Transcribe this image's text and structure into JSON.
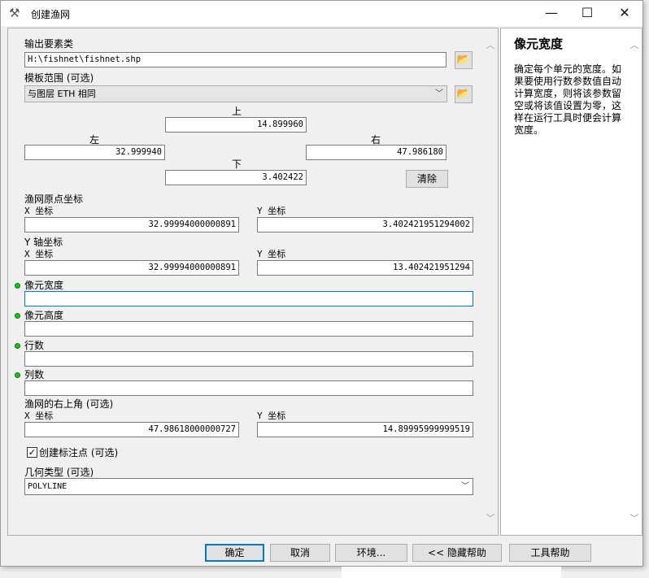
{
  "window": {
    "title": "创建渔网",
    "minimize_glyph": "—",
    "maximize_glyph": "☐",
    "close_glyph": "✕"
  },
  "icons": {
    "title_icon": "hammer-icon",
    "folder_icon": "open-folder-icon",
    "chevron": "chevron-down-icon",
    "scroll_up": "scroll-up-icon",
    "scroll_down": "scroll-down-icon"
  },
  "form": {
    "output_label": "输出要素类",
    "output_value": "H:\\fishnet\\fishnet.shp",
    "template_label": "模板范围 (可选)",
    "template_value": "与图层 ETH 相同",
    "extent": {
      "top_label": "上",
      "top_value": "14.899960",
      "left_label": "左",
      "left_value": "32.999940",
      "right_label": "右",
      "right_value": "47.986180",
      "bottom_label": "下",
      "bottom_value": "3.402422",
      "clear_button": "清除"
    },
    "origin_label": "渔网原点坐标",
    "origin_x_label": "X 坐标",
    "origin_x_value": "32.99994000000891",
    "origin_y_label": "Y 坐标",
    "origin_y_value": "3.402421951294002",
    "yaxis_label": "Y 轴坐标",
    "yaxis_x_label": "X 坐标",
    "yaxis_x_value": "32.99994000000891",
    "yaxis_y_label": "Y 坐标",
    "yaxis_y_value": "13.402421951294",
    "cell_width_label": "像元宽度",
    "cell_width_value": "",
    "cell_height_label": "像元高度",
    "cell_height_value": "",
    "rows_label": "行数",
    "rows_value": "",
    "cols_label": "列数",
    "cols_value": "",
    "corner_label": "渔网的右上角 (可选)",
    "corner_x_label": "X 坐标",
    "corner_x_value": "47.98618000000727",
    "corner_y_label": "Y 坐标",
    "corner_y_value": "14.89995999999519",
    "label_points_checkbox": "创建标注点 (可选)",
    "label_points_checked": "✓",
    "geometry_label": "几何类型 (可选)",
    "geometry_value": "POLYLINE"
  },
  "help": {
    "title": "像元宽度",
    "body": "确定每个单元的宽度。如果要使用行数参数值自动计算宽度，则将该参数留空或将该值设置为零，这样在运行工具时便会计算宽度。"
  },
  "buttons": {
    "ok": "确定",
    "cancel": "取消",
    "environments": "环境...",
    "hide_help": "<< 隐藏帮助",
    "tool_help": "工具帮助"
  },
  "colors": {
    "required_dot": "#17c417",
    "focus_border": "#0078d7"
  }
}
